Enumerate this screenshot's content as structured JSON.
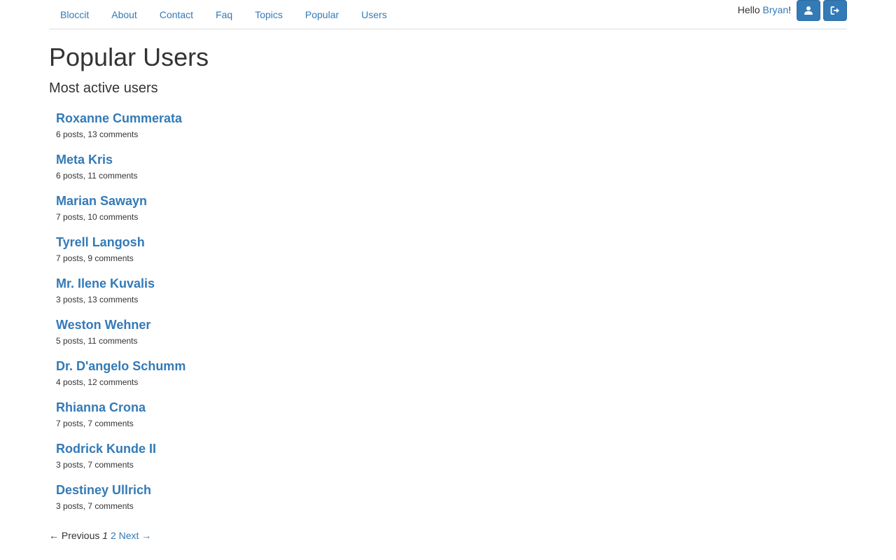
{
  "nav": {
    "items": [
      {
        "label": "Bloccit"
      },
      {
        "label": "About"
      },
      {
        "label": "Contact"
      },
      {
        "label": "Faq"
      },
      {
        "label": "Topics"
      },
      {
        "label": "Popular"
      },
      {
        "label": "Users"
      }
    ],
    "greeting_prefix": "Hello ",
    "user_name": "Bryan",
    "greeting_suffix": "!",
    "profile_icon": "user-icon",
    "signout_icon": "sign-out-icon",
    "button_color": "#337ab7"
  },
  "page": {
    "title": "Popular Users",
    "subtitle": "Most active users"
  },
  "users": [
    {
      "name": "Roxanne Cummerata",
      "stats": "6 posts, 13 comments"
    },
    {
      "name": "Meta Kris",
      "stats": "6 posts, 11 comments"
    },
    {
      "name": "Marian Sawayn",
      "stats": "7 posts, 10 comments"
    },
    {
      "name": "Tyrell Langosh",
      "stats": "7 posts, 9 comments"
    },
    {
      "name": "Mr. Ilene Kuvalis",
      "stats": "3 posts, 13 comments"
    },
    {
      "name": "Weston Wehner",
      "stats": "5 posts, 11 comments"
    },
    {
      "name": "Dr. D'angelo Schumm",
      "stats": "4 posts, 12 comments"
    },
    {
      "name": "Rhianna Crona",
      "stats": "7 posts, 7 comments"
    },
    {
      "name": "Rodrick Kunde II",
      "stats": "3 posts, 7 comments"
    },
    {
      "name": "Destiney Ullrich",
      "stats": "3 posts, 7 comments"
    }
  ],
  "pagination": {
    "previous": "← Previous",
    "current": "1",
    "next_page": "2",
    "next": "Next →"
  },
  "colors": {
    "link": "#337ab7",
    "text": "#333333"
  }
}
